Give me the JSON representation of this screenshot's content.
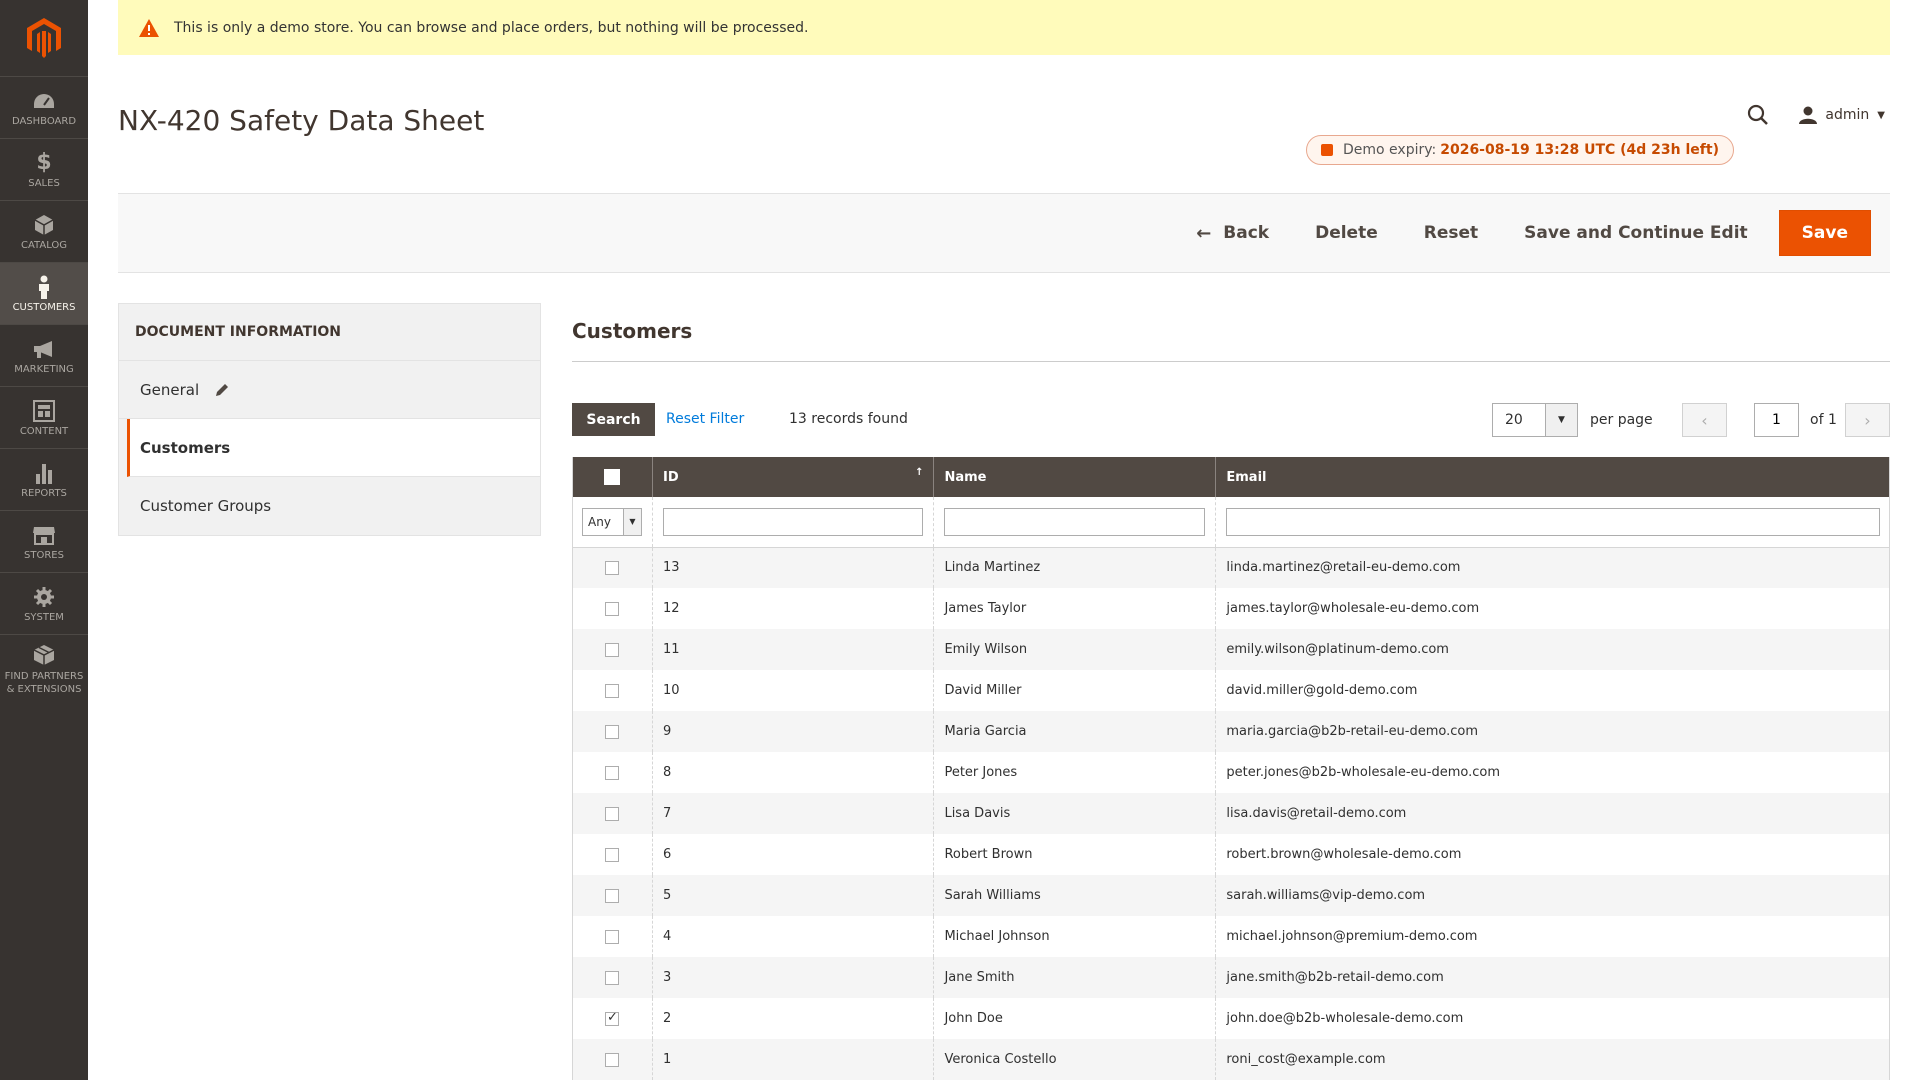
{
  "banner": {
    "text": "This is only a demo store. You can browse and place orders, but nothing will be processed."
  },
  "sidebar": {
    "items": [
      {
        "label": "DASHBOARD",
        "icon": "dashboard-icon"
      },
      {
        "label": "SALES",
        "icon": "dollar-icon"
      },
      {
        "label": "CATALOG",
        "icon": "box-icon"
      },
      {
        "label": "CUSTOMERS",
        "icon": "person-icon",
        "active": true
      },
      {
        "label": "MARKETING",
        "icon": "megaphone-icon"
      },
      {
        "label": "CONTENT",
        "icon": "content-icon"
      },
      {
        "label": "REPORTS",
        "icon": "bar-chart-icon"
      },
      {
        "label": "STORES",
        "icon": "store-icon"
      },
      {
        "label": "SYSTEM",
        "icon": "gear-icon"
      },
      {
        "label": "FIND PARTNERS & EXTENSIONS",
        "icon": "extensions-icon"
      }
    ]
  },
  "header": {
    "title": "NX-420 Safety Data Sheet",
    "user": "admin",
    "expiry_label": "Demo expiry:",
    "expiry_value": "2026-08-19 13:28 UTC (4d 23h left)"
  },
  "actions": {
    "back": "Back",
    "delete": "Delete",
    "reset": "Reset",
    "save_continue": "Save and Continue Edit",
    "save": "Save"
  },
  "tabs": {
    "heading": "DOCUMENT INFORMATION",
    "items": [
      "General",
      "Customers",
      "Customer Groups"
    ]
  },
  "customers": {
    "section_title": "Customers",
    "search_label": "Search",
    "reset_filter_label": "Reset Filter",
    "records_found": "13 records found",
    "per_page_value": "20",
    "per_page_label": "per page",
    "page_current": "1",
    "page_of": "of 1",
    "filter_any": "Any",
    "columns": [
      "ID",
      "Name",
      "Email"
    ],
    "rows": [
      {
        "id": "13",
        "name": "Linda Martinez",
        "email": "linda.martinez@retail-eu-demo.com",
        "checked": false
      },
      {
        "id": "12",
        "name": "James Taylor",
        "email": "james.taylor@wholesale-eu-demo.com",
        "checked": false
      },
      {
        "id": "11",
        "name": "Emily Wilson",
        "email": "emily.wilson@platinum-demo.com",
        "checked": false
      },
      {
        "id": "10",
        "name": "David Miller",
        "email": "david.miller@gold-demo.com",
        "checked": false
      },
      {
        "id": "9",
        "name": "Maria Garcia",
        "email": "maria.garcia@b2b-retail-eu-demo.com",
        "checked": false
      },
      {
        "id": "8",
        "name": "Peter Jones",
        "email": "peter.jones@b2b-wholesale-eu-demo.com",
        "checked": false
      },
      {
        "id": "7",
        "name": "Lisa Davis",
        "email": "lisa.davis@retail-demo.com",
        "checked": false
      },
      {
        "id": "6",
        "name": "Robert Brown",
        "email": "robert.brown@wholesale-demo.com",
        "checked": false
      },
      {
        "id": "5",
        "name": "Sarah Williams",
        "email": "sarah.williams@vip-demo.com",
        "checked": false
      },
      {
        "id": "4",
        "name": "Michael Johnson",
        "email": "michael.johnson@premium-demo.com",
        "checked": false
      },
      {
        "id": "3",
        "name": "Jane Smith",
        "email": "jane.smith@b2b-retail-demo.com",
        "checked": false
      },
      {
        "id": "2",
        "name": "John Doe",
        "email": "john.doe@b2b-wholesale-demo.com",
        "checked": true
      },
      {
        "id": "1",
        "name": "Veronica Costello",
        "email": "roni_cost@example.com",
        "checked": false
      }
    ]
  },
  "colors": {
    "accent": "#eb5202",
    "sidebar": "#373330",
    "header_dark": "#514943",
    "link": "#007bdb",
    "banner": "#fffbbb"
  }
}
